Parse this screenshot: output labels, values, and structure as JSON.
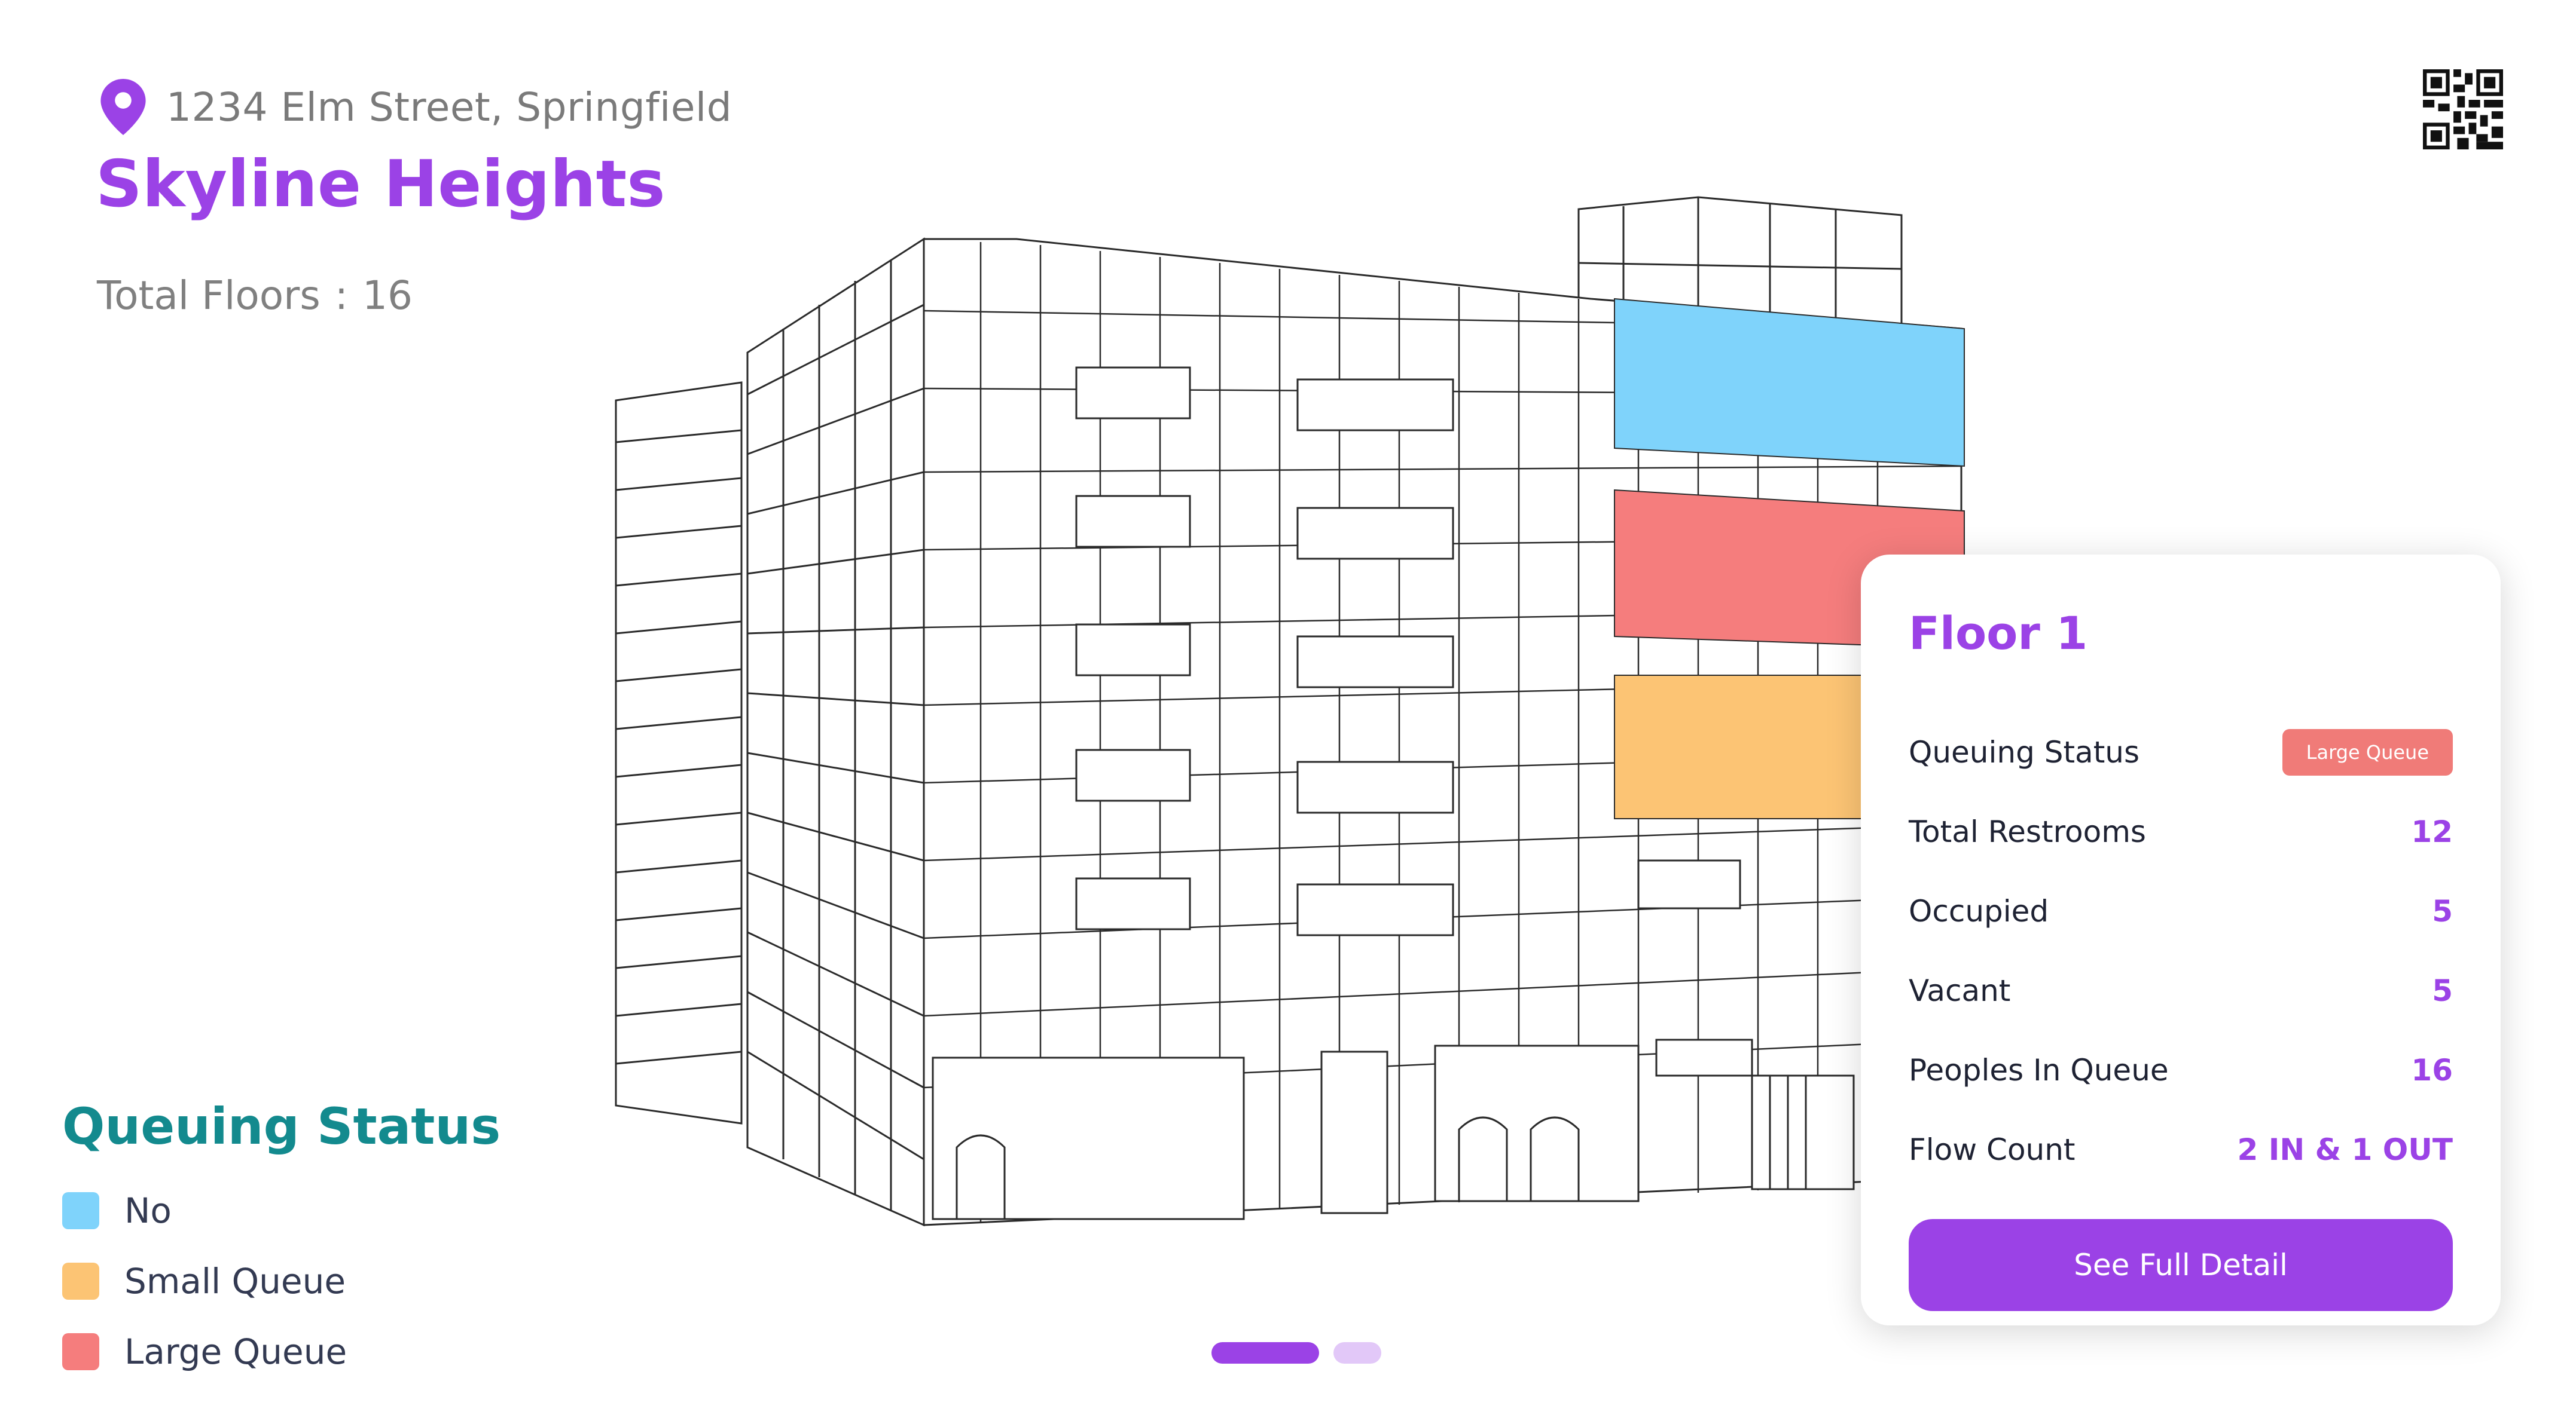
{
  "header": {
    "address": "1234 Elm Street, Springfield",
    "building_name": "Skyline Heights",
    "total_floors_label": "Total Floors",
    "total_floors_separator": ":",
    "total_floors_value": "16",
    "qr_icon": "qr-code-icon",
    "location_icon": "location-pin-icon"
  },
  "legend": {
    "title": "Queuing Status",
    "items": [
      {
        "label": "No",
        "color": "#7fd3fb"
      },
      {
        "label": "Small Queue",
        "color": "#fcc474"
      },
      {
        "label": "Large Queue",
        "color": "#f57d7d"
      }
    ]
  },
  "floor_card": {
    "title": "Floor 1",
    "rows": [
      {
        "label": "Queuing Status",
        "badge": "Large Queue"
      },
      {
        "label": "Total Restrooms",
        "value": "12"
      },
      {
        "label": "Occupied",
        "value": "5"
      },
      {
        "label": "Vacant",
        "value": "5"
      },
      {
        "label": "Peoples In Queue",
        "value": "16"
      },
      {
        "label": "Flow Count",
        "value": "2 IN  & 1 OUT"
      }
    ],
    "button_label": "See Full Detail"
  },
  "pager": {
    "active_index": 0,
    "count": 2
  },
  "colors": {
    "accent": "#9b42e6",
    "legend_title": "#138a8e",
    "no_queue": "#7fd3fb",
    "small_queue": "#fcc474",
    "large_queue": "#f57d7d"
  }
}
